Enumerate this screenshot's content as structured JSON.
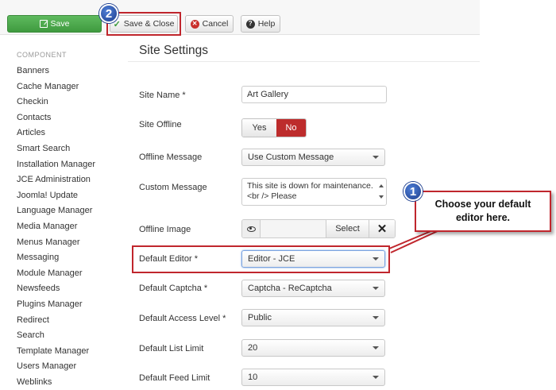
{
  "toolbar": {
    "save_label": "Save",
    "save_close_label": "Save & Close",
    "cancel_label": "Cancel",
    "help_label": "Help"
  },
  "badges": {
    "step1": "1",
    "step2": "2"
  },
  "sidebar": {
    "heading": "COMPONENT",
    "items": [
      "Banners",
      "Cache Manager",
      "Checkin",
      "Contacts",
      "Articles",
      "Smart Search",
      "Installation Manager",
      "JCE Administration",
      "Joomla! Update",
      "Language Manager",
      "Media Manager",
      "Menus Manager",
      "Messaging",
      "Module Manager",
      "Newsfeeds",
      "Plugins Manager",
      "Redirect",
      "Search",
      "Template Manager",
      "Users Manager",
      "Weblinks"
    ]
  },
  "main": {
    "title": "Site Settings",
    "fields": {
      "site_name": {
        "label": "Site Name *",
        "value": "Art Gallery"
      },
      "site_offline": {
        "label": "Site Offline",
        "yes": "Yes",
        "no": "No",
        "selected": "No"
      },
      "offline_message": {
        "label": "Offline Message",
        "value": "Use Custom Message"
      },
      "custom_message": {
        "label": "Custom Message",
        "value": "This site is down for maintenance.<br /> Please"
      },
      "offline_image": {
        "label": "Offline Image",
        "select_label": "Select",
        "clear_label": "✕"
      },
      "default_editor": {
        "label": "Default Editor *",
        "value": "Editor - JCE"
      },
      "default_captcha": {
        "label": "Default Captcha *",
        "value": "Captcha - ReCaptcha"
      },
      "default_access_level": {
        "label": "Default Access Level *",
        "value": "Public"
      },
      "default_list_limit": {
        "label": "Default List Limit",
        "value": "20"
      },
      "default_feed_limit": {
        "label": "Default Feed Limit",
        "value": "10"
      }
    }
  },
  "callout": {
    "text": "Choose your default editor here."
  },
  "colors": {
    "save_green": "#4aa84a",
    "offline_no_red": "#bd2c2c",
    "highlight_red": "#c0262d",
    "badge_blue": "#2a52a8"
  },
  "icons": {
    "save": "save-icon",
    "save_close": "check-icon",
    "cancel": "cancel-icon",
    "help": "help-icon",
    "preview": "eye-icon",
    "clear": "close-icon"
  }
}
